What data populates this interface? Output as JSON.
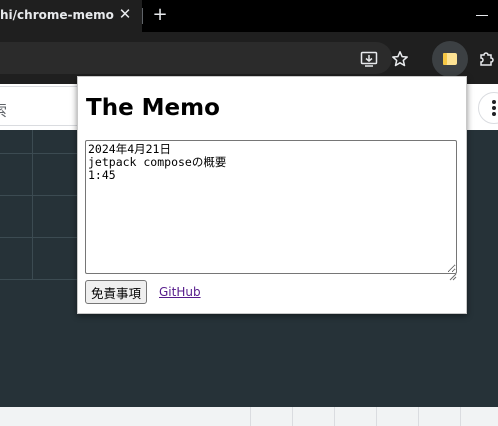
{
  "browser": {
    "tab": {
      "title": "hi/chrome-memo",
      "close_symbol": "✕"
    },
    "new_tab_symbol": "+"
  },
  "page": {
    "search_label": "索"
  },
  "popup": {
    "title": "The Memo",
    "memo_text": "2024年4月21日\njetpack composeの概要\n1:45",
    "disclaimer_label": "免責事項",
    "github_label": "GitHub"
  },
  "colors": {
    "titlebar_bg": "#000000",
    "toolbar_bg": "#1f1f1f",
    "page_bg": "#263238",
    "link_visited": "#551a8b"
  }
}
